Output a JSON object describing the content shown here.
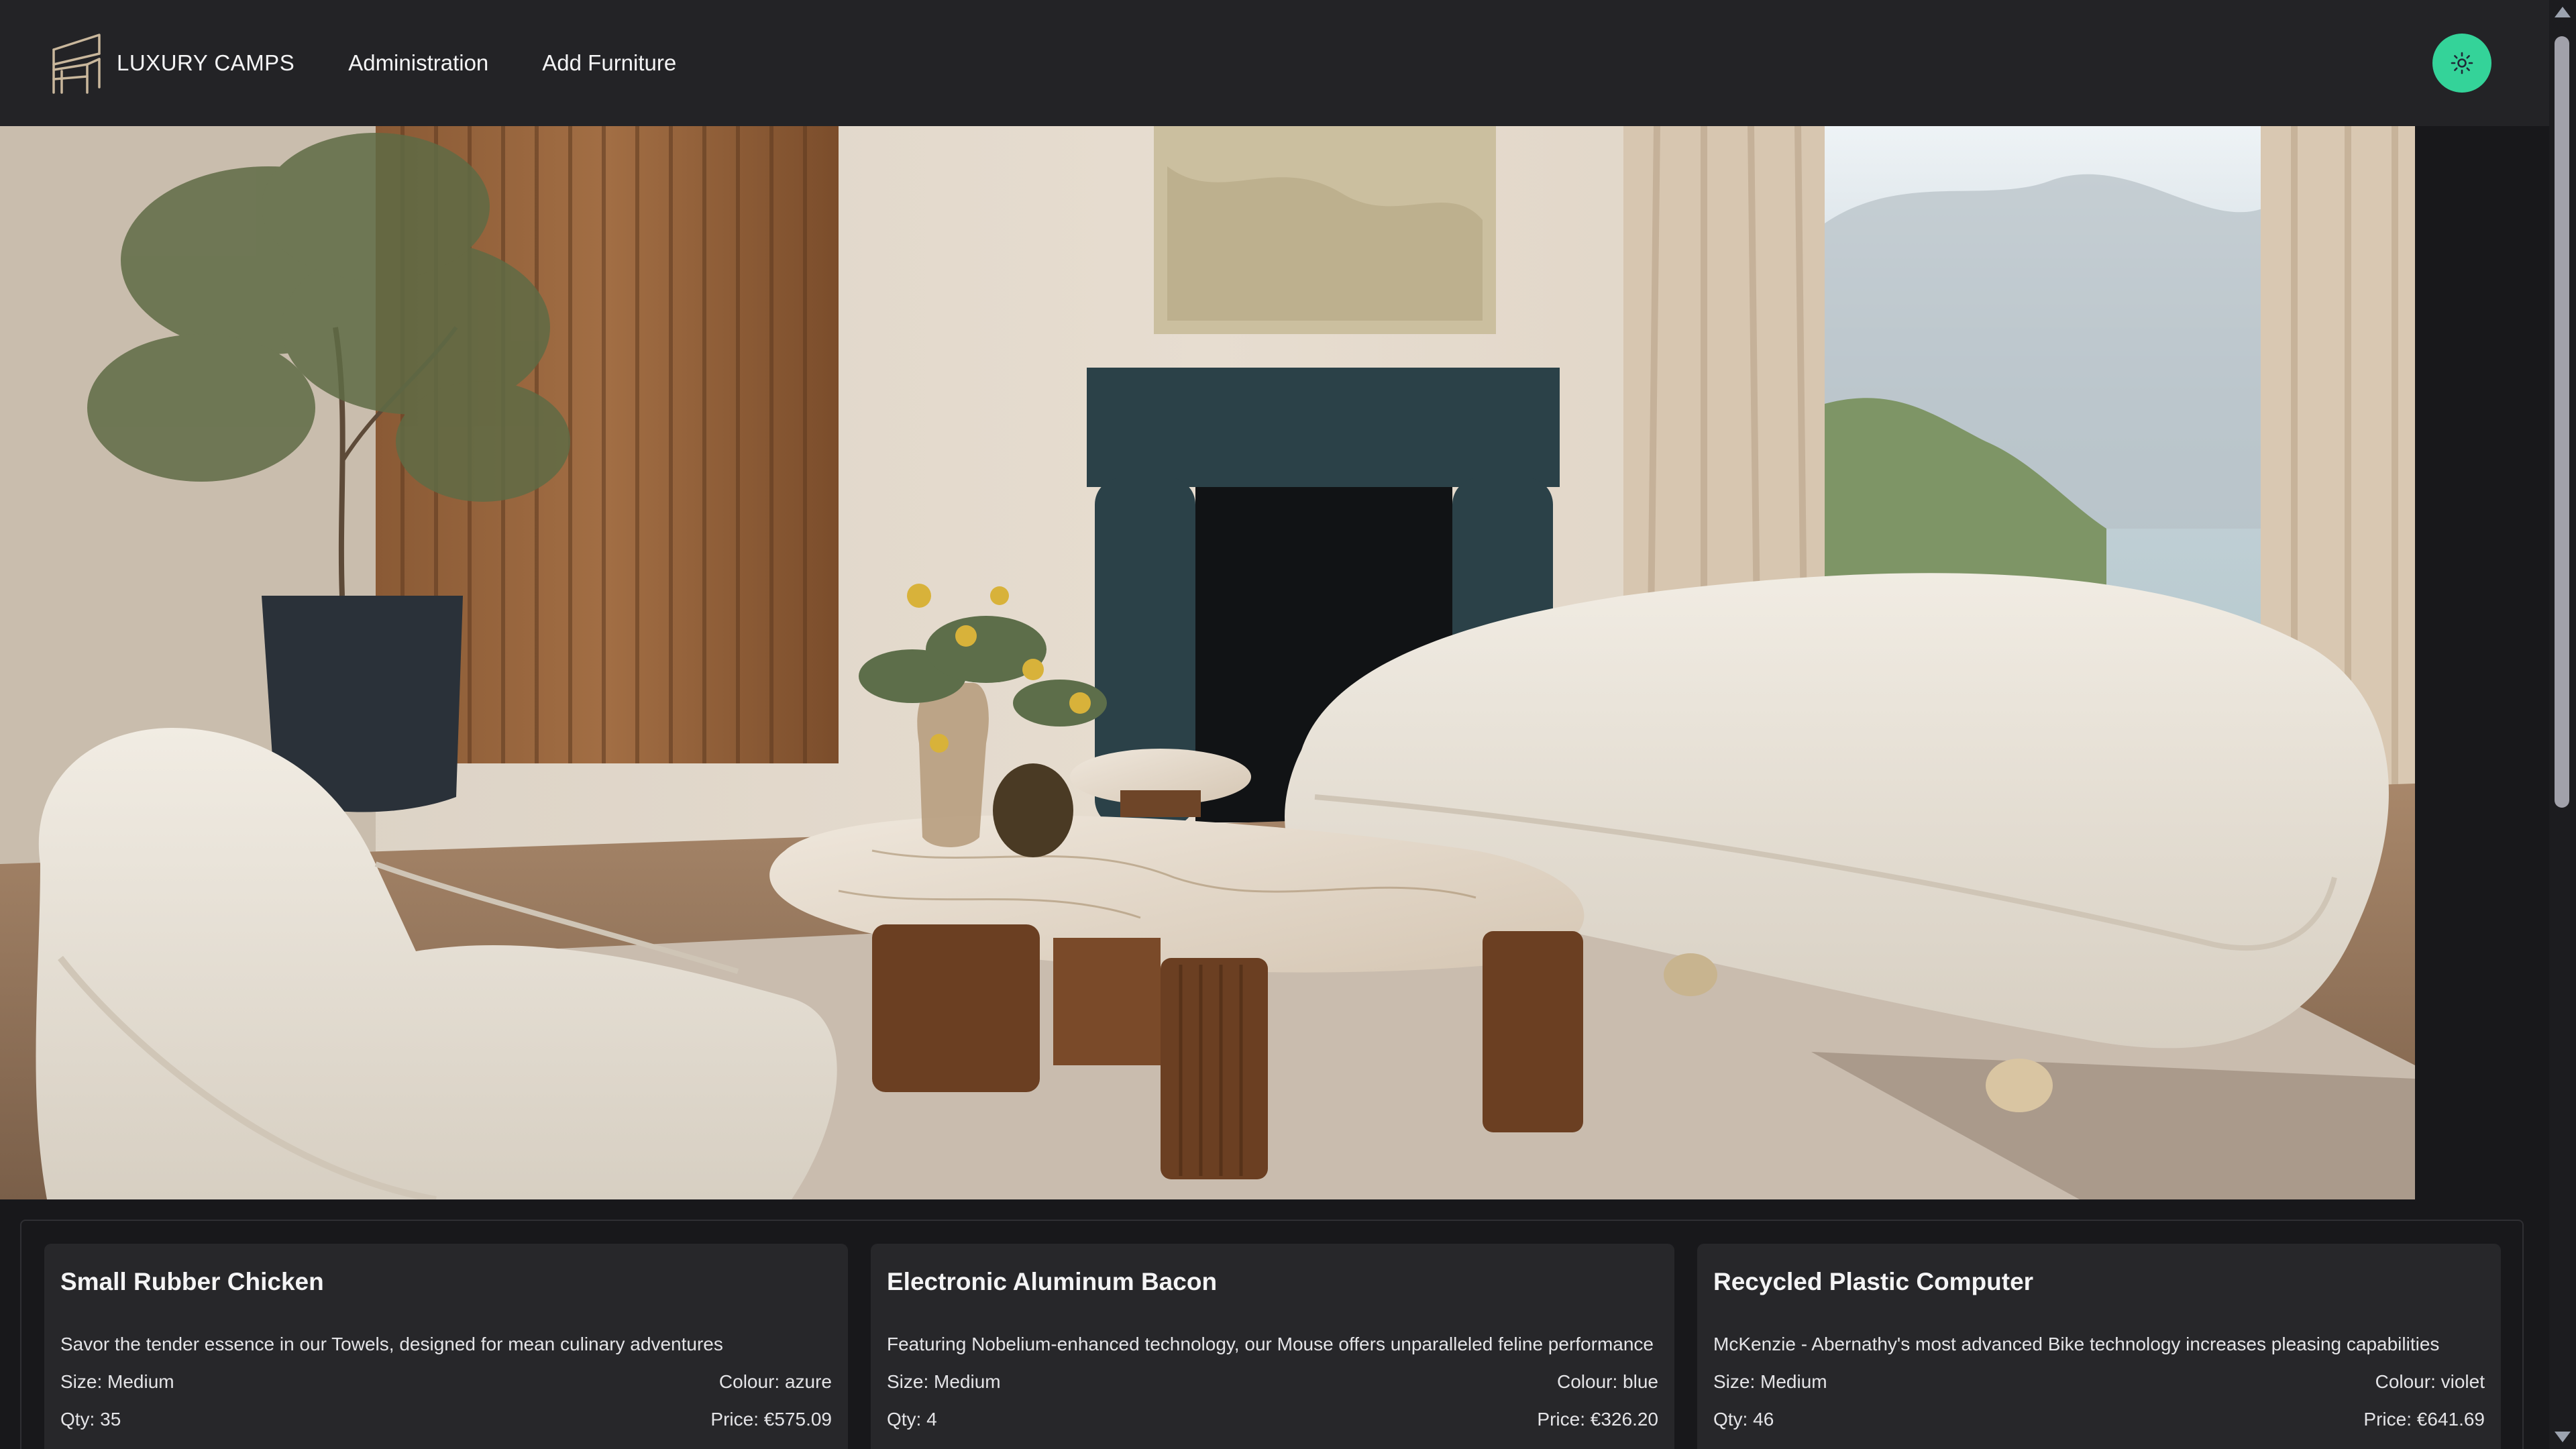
{
  "nav": {
    "brand": "LUXURY CAMPS",
    "links": [
      {
        "label": "Administration"
      },
      {
        "label": "Add Furniture"
      }
    ],
    "theme_toggle_icon": "sun-icon",
    "accent_color": "#34d399"
  },
  "hero": {
    "icon": "living-room-photo"
  },
  "products": [
    {
      "title": "Small Rubber Chicken",
      "description": "Savor the tender essence in our Towels, designed for mean culinary adventures",
      "size": "Size: Medium",
      "colour": "Colour: azure",
      "qty": "Qty: 35",
      "price": "Price: €575.09"
    },
    {
      "title": "Electronic Aluminum Bacon",
      "description": "Featuring Nobelium-enhanced technology, our Mouse offers unparalleled feline performance",
      "size": "Size: Medium",
      "colour": "Colour: blue",
      "qty": "Qty: 4",
      "price": "Price: €326.20"
    },
    {
      "title": "Recycled Plastic Computer",
      "description": "McKenzie - Abernathy's most advanced Bike technology increases pleasing capabilities",
      "size": "Size: Medium",
      "colour": "Colour: violet",
      "qty": "Qty: 46",
      "price": "Price: €641.69"
    }
  ]
}
